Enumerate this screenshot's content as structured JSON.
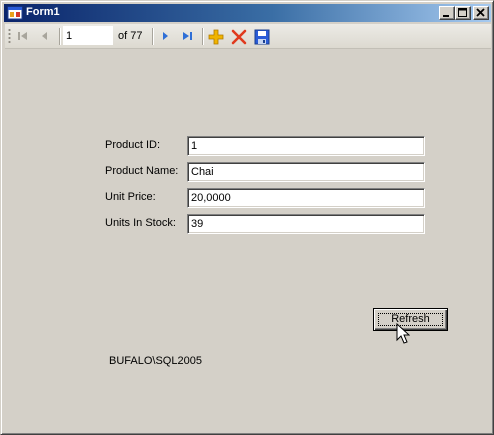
{
  "window": {
    "title": "Form1",
    "icons": {
      "app": "form-app-icon",
      "minimize": "minimize-icon",
      "maximize": "maximize-icon",
      "close": "close-icon"
    }
  },
  "navigator": {
    "position": "1",
    "count_label": "of 77",
    "icons": [
      "move-first-icon",
      "move-previous-icon",
      "move-next-icon",
      "move-last-icon",
      "add-new-icon",
      "delete-icon",
      "save-icon"
    ]
  },
  "form": {
    "fields": [
      {
        "label": "Product ID:",
        "value": "1"
      },
      {
        "label": "Product Name:",
        "value": "Chai"
      },
      {
        "label": "Unit Price:",
        "value": "20,0000"
      },
      {
        "label": "Units In Stock:",
        "value": "39"
      }
    ],
    "refresh_label": "Refresh",
    "server": "BUFALO\\SQL2005"
  },
  "colors": {
    "titlebar_start": "#0a246a",
    "titlebar_end": "#a6caf0",
    "face": "#d4d0c8",
    "delete_red": "#e03a1e",
    "add_yellow": "#f0b400",
    "nav_blue": "#2f6fd6"
  }
}
